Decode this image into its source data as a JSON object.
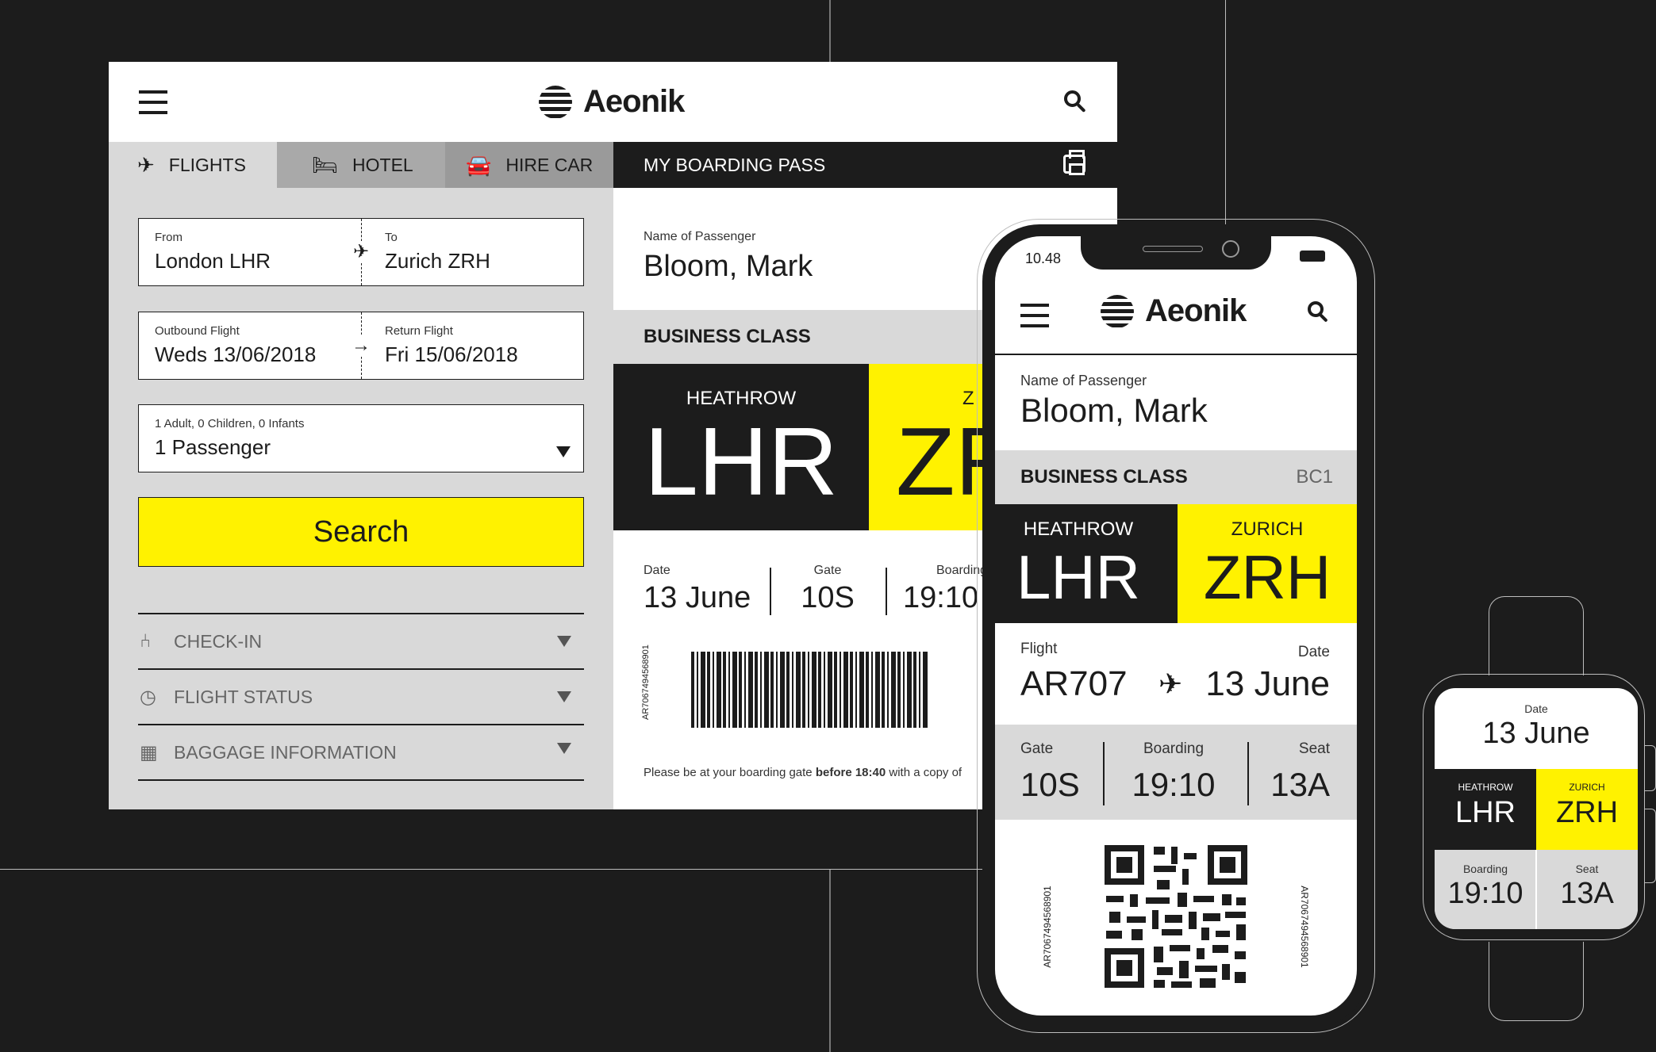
{
  "brand": {
    "name": "Aeonik",
    "yellow": "#fff200",
    "dark": "#1c1c1c",
    "grey": "#d9d9d9"
  },
  "tablet": {
    "tabs": [
      {
        "icon": "plane-icon",
        "label": "FLIGHTS"
      },
      {
        "icon": "hotel-icon",
        "label": "HOTEL"
      },
      {
        "icon": "car-icon",
        "label": "HIRE CAR"
      }
    ],
    "route": {
      "from_label": "From",
      "from_value": "London LHR",
      "to_label": "To",
      "to_value": "Zurich ZRH"
    },
    "dates": {
      "outbound_label": "Outbound Flight",
      "outbound_value": "Weds 13/06/2018",
      "return_label": "Return Flight",
      "return_value": "Fri 15/06/2018"
    },
    "passengers": {
      "label": "1 Adult, 0 Children, 0 Infants",
      "value": "1 Passenger"
    },
    "search_label": "Search",
    "accordion": [
      {
        "icon": "seat-icon",
        "label": "CHECK-IN"
      },
      {
        "icon": "clock-icon",
        "label": "FLIGHT STATUS"
      },
      {
        "icon": "baggage-icon",
        "label": "BAGGAGE INFORMATION"
      }
    ],
    "boarding_pass": {
      "heading": "MY BOARDING PASS",
      "passenger_label": "Name of Passenger",
      "passenger_name": "Bloom, Mark",
      "class": "BUSINESS CLASS",
      "from_city": "HEATHROW",
      "from_code": "LHR",
      "to_code_partial": "ZR",
      "to_city_partial": "Z",
      "date_label": "Date",
      "date_value": "13 June",
      "gate_label": "Gate",
      "gate_value": "10S",
      "boarding_label": "Boarding",
      "boarding_value": "19:10",
      "barcode_number": "AR7067494568901",
      "notice_prefix": "Please be at your boarding gate ",
      "notice_bold": "before 18:40",
      "notice_suffix": " with a copy of"
    }
  },
  "phone": {
    "time": "10.48",
    "passenger_label": "Name of Passenger",
    "passenger_name": "Bloom, Mark",
    "class": "BUSINESS CLASS",
    "class_code": "BC1",
    "from_city": "HEATHROW",
    "from_code": "LHR",
    "to_city": "ZURICH",
    "to_code": "ZRH",
    "flight_label": "Flight",
    "flight_value": "AR707",
    "date_label": "Date",
    "date_value": "13 June",
    "gate_label": "Gate",
    "gate_value": "10S",
    "boarding_label": "Boarding",
    "boarding_value": "19:10",
    "seat_label": "Seat",
    "seat_value": "13A",
    "qr_number": "AR7067494568901"
  },
  "watch": {
    "date_label": "Date",
    "date_value": "13 June",
    "from_city": "HEATHROW",
    "from_code": "LHR",
    "to_city": "ZURICH",
    "to_code": "ZRH",
    "boarding_label": "Boarding",
    "boarding_value": "19:10",
    "seat_label": "Seat",
    "seat_value": "13A"
  }
}
